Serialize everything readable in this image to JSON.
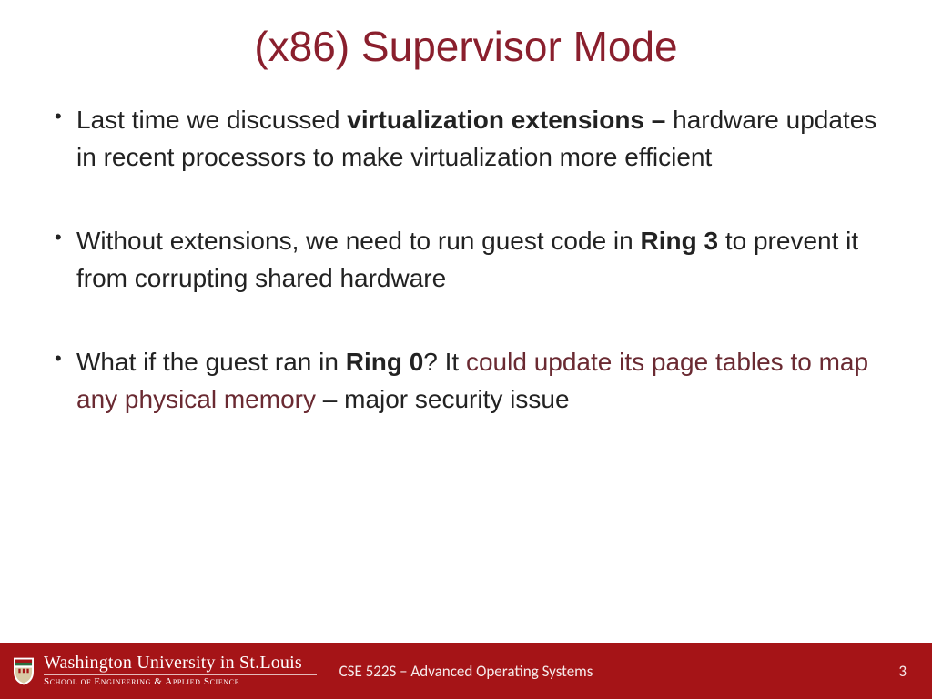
{
  "title": "(x86) Supervisor Mode",
  "bullets": {
    "b1": {
      "pre": "Last time we discussed ",
      "bold": "virtualization extensions – ",
      "post": "hardware updates in recent processors to make virtualization more efficient"
    },
    "b2": {
      "pre": "Without extensions, we need to run guest code in ",
      "bold": "Ring 3",
      "post": " to prevent it from corrupting shared hardware"
    },
    "b3": {
      "pre": "What if the guest ran in ",
      "bold": "Ring 0",
      "mid": "? It ",
      "accent": "could update its page tables to map any physical memory",
      "post": " – major security issue"
    }
  },
  "footer": {
    "university": "Washington University in St.Louis",
    "school": "School of Engineering & Applied Science",
    "course": "CSE 522S – Advanced Operating Systems",
    "page": "3"
  }
}
